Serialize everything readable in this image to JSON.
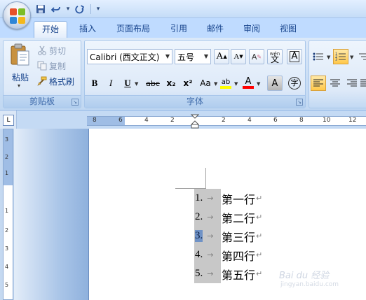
{
  "tabs": [
    "开始",
    "插入",
    "页面布局",
    "引用",
    "邮件",
    "审阅",
    "视图"
  ],
  "clipboard": {
    "paste_label": "粘贴",
    "cut_label": "剪切",
    "copy_label": "复制",
    "format_painter_label": "格式刷",
    "group_label": "剪贴板"
  },
  "font": {
    "font_name": "Calibri (西文正文)",
    "font_size": "五号",
    "group_label": "字体",
    "bold": "B",
    "italic": "I",
    "underline": "U",
    "strike": "abc",
    "subscript": "x₂",
    "superscript": "x²",
    "change_case": "Aa",
    "grow": "A",
    "shrink": "A",
    "clear_format": "A",
    "phonetic": "wén",
    "phonetic_char": "文",
    "border_char": "A",
    "shade_char": "A",
    "enclose_char": "字",
    "highlight": "ab",
    "font_color": "A"
  },
  "ruler": {
    "tab_selector": "L",
    "h_numbers": [
      "8",
      "6",
      "4",
      "2",
      "2",
      "4",
      "6",
      "8",
      "10",
      "12"
    ],
    "v_numbers": [
      "3",
      "2",
      "1",
      "1",
      "2",
      "3",
      "4",
      "5"
    ]
  },
  "document": {
    "items": [
      {
        "num": "1.",
        "text": "第一行"
      },
      {
        "num": "2.",
        "text": "第二行"
      },
      {
        "num": "3.",
        "text": "第三行"
      },
      {
        "num": "4.",
        "text": "第四行"
      },
      {
        "num": "5.",
        "text": "第五行"
      }
    ],
    "tab_arrow": "→",
    "para_mark": "↵"
  },
  "watermark": {
    "text": "Bai du 经验",
    "sub": "jingyan.baidu.com"
  },
  "colors": {
    "highlight_bar": "#ffff00",
    "font_color_bar": "#ff0000",
    "selected_number_bg": "#6f92c6",
    "list_number_bg": "#c8c8c8"
  }
}
